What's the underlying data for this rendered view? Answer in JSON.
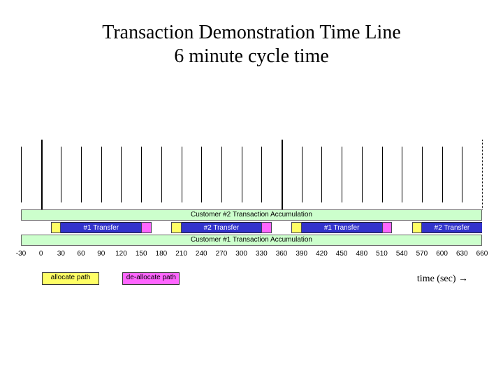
{
  "chart_data": {
    "type": "bar",
    "title": "Transaction Demonstration Time Line",
    "subtitle": "6 minute cycle time",
    "xlabel": "time (sec) →",
    "ylabel": "",
    "x_range": [
      -30,
      660
    ],
    "tick_interval": 30,
    "tick_values": [
      -30,
      0,
      30,
      60,
      90,
      120,
      150,
      180,
      210,
      240,
      270,
      300,
      330,
      360,
      390,
      420,
      450,
      480,
      510,
      540,
      570,
      600,
      630,
      660
    ],
    "major_ticks": [
      0,
      360
    ],
    "dotted_ticks": [
      660
    ],
    "rows": [
      {
        "kind": "accumulation",
        "label": "Customer #2 Transaction Accumulation",
        "start": -30,
        "end": 660
      },
      {
        "kind": "transfers",
        "items": [
          {
            "label": "#1 Transfer",
            "start": 15,
            "end": 165,
            "alloc_width": 15,
            "dealloc_width": 15
          },
          {
            "label": "#2 Transfer",
            "start": 195,
            "end": 345,
            "alloc_width": 15,
            "dealloc_width": 15
          },
          {
            "label": "#1 Transfer",
            "start": 375,
            "end": 525,
            "alloc_width": 15,
            "dealloc_width": 15
          },
          {
            "label": "#2 Transfer",
            "start": 555,
            "end": 660,
            "alloc_width": 15,
            "dealloc_width": 0
          }
        ]
      },
      {
        "kind": "accumulation",
        "label": "Customer #1 Transaction Accumulation",
        "start": -30,
        "end": 660
      }
    ],
    "legend": [
      {
        "kind": "alloc",
        "label": "allocate path",
        "color": "#ffff66"
      },
      {
        "kind": "dealloc",
        "label": "de-allocate path",
        "color": "#ff66ff"
      }
    ]
  },
  "title": {
    "line1": "Transaction Demonstration Time Line",
    "line2": "6 minute cycle time"
  },
  "time_label": "time (sec) →",
  "legend": {
    "alloc": "allocate path",
    "dealloc": "de-allocate path"
  }
}
